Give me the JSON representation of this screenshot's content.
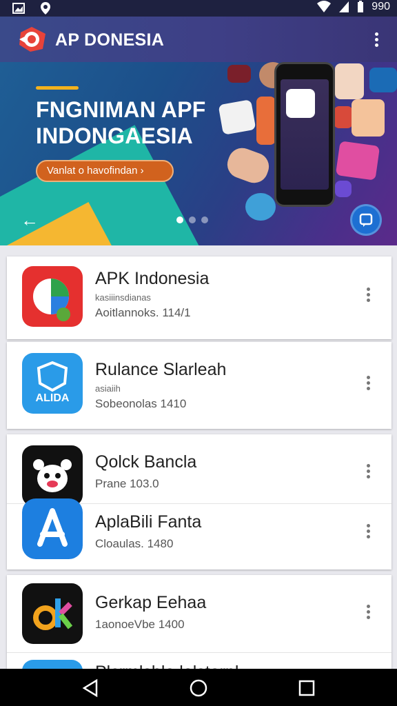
{
  "status_bar": {
    "time": "990"
  },
  "app_bar": {
    "title": "AP DONESIA"
  },
  "hero": {
    "title_line1": "FNGNIMAN APF",
    "title_line2": "INDONGAESIA",
    "cta_label": "Vanlat o havofindan ›"
  },
  "apps": [
    {
      "name": "APK Indonesia",
      "sub1": "kasiiinsdianas",
      "sub2": "Aoitlannoks. 114/1"
    },
    {
      "name": "Rulance Slarleah",
      "sub1": "asiaiih",
      "sub2": "Sobeonolas 1410"
    },
    {
      "name": "Qolck Bancla",
      "sub2": "Prane 103.0"
    },
    {
      "name": "AplaBili Fanta",
      "sub2": "Cloaulas. 1480"
    },
    {
      "name": "Gerkap Eehaa",
      "sub2": "1aonoeVbe 1400"
    },
    {
      "name": "Plcrmlsble lelstarnl"
    }
  ],
  "colors": {
    "accent": "#d1621e",
    "app_bar": "#3e3f86",
    "fab": "#1d6fd2"
  }
}
